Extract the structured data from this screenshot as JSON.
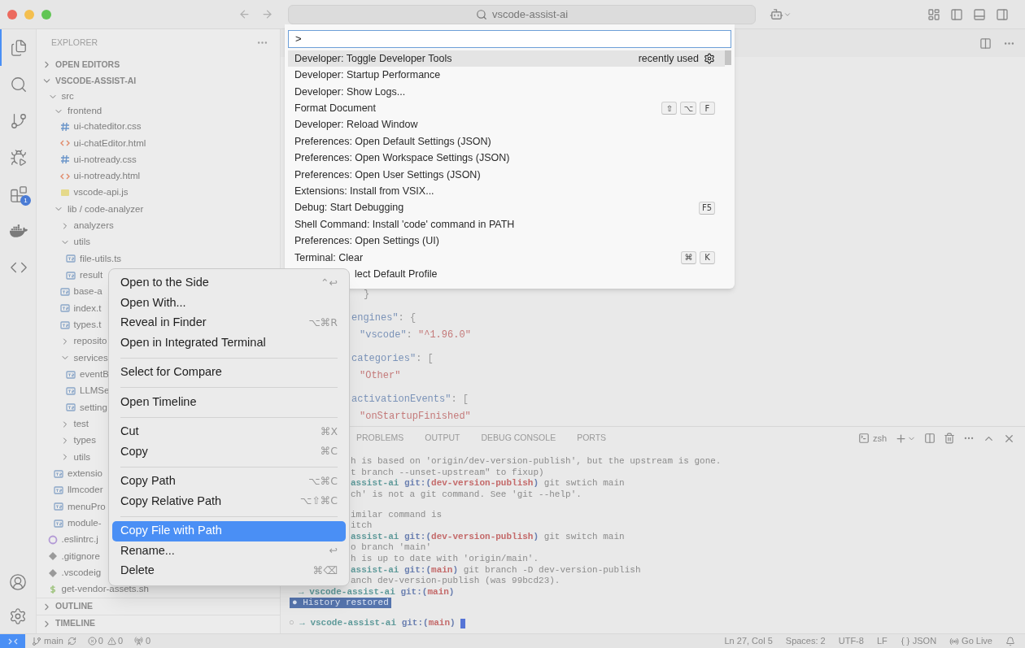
{
  "title_bar": {
    "search": "vscode-assist-ai"
  },
  "activity_bar": {
    "items": [
      {
        "kind": "files",
        "selected": true
      },
      {
        "kind": "search",
        "selected": false
      },
      {
        "kind": "source-control",
        "selected": false
      },
      {
        "kind": "run",
        "selected": false
      },
      {
        "kind": "extensions",
        "selected": false,
        "badge": "1"
      },
      {
        "kind": "docker",
        "selected": false
      },
      {
        "kind": "code",
        "selected": false
      }
    ],
    "bottom": [
      {
        "kind": "account"
      },
      {
        "kind": "settings"
      }
    ]
  },
  "sidebar": {
    "title": "EXPLORER",
    "sections": [
      {
        "label": "OPEN EDITORS",
        "expanded": false
      },
      {
        "label": "VSCODE-ASSIST-AI",
        "expanded": true
      }
    ],
    "tree": [
      {
        "name": "src",
        "kind": "folder",
        "expanded": true,
        "children": [
          {
            "name": "frontend",
            "kind": "folder",
            "expanded": true,
            "children": [
              {
                "name": "ui-chateditor.css",
                "kind": "css"
              },
              {
                "name": "ui-chatEditor.html",
                "kind": "html"
              },
              {
                "name": "ui-notready.css",
                "kind": "css"
              },
              {
                "name": "ui-notready.html",
                "kind": "html"
              },
              {
                "name": "vscode-api.js",
                "kind": "js"
              }
            ]
          },
          {
            "name": "lib / code-analyzer",
            "kind": "folder",
            "expanded": true,
            "children": [
              {
                "name": "analyzers",
                "kind": "folder",
                "expanded": false
              },
              {
                "name": "utils",
                "kind": "folder",
                "expanded": true,
                "children": [
                  {
                    "name": "file-utils.ts",
                    "kind": "ts"
                  },
                  {
                    "name": "result",
                    "kind": "ts"
                  }
                ]
              },
              {
                "name": "base-a",
                "kind": "ts"
              },
              {
                "name": "index.t",
                "kind": "ts"
              },
              {
                "name": "types.t",
                "kind": "ts"
              },
              {
                "name": "reposito",
                "kind": "folder",
                "expanded": false
              },
              {
                "name": "services",
                "kind": "folder",
                "expanded": true,
                "children": [
                  {
                    "name": "eventB",
                    "kind": "ts"
                  },
                  {
                    "name": "LLMSe",
                    "kind": "ts"
                  },
                  {
                    "name": "setting",
                    "kind": "ts"
                  }
                ]
              },
              {
                "name": "test",
                "kind": "folder",
                "expanded": false
              },
              {
                "name": "types",
                "kind": "folder",
                "expanded": false
              },
              {
                "name": "utils",
                "kind": "folder",
                "expanded": false
              }
            ]
          },
          {
            "name": "extensio",
            "kind": "ts"
          },
          {
            "name": "llmcoder",
            "kind": "ts"
          },
          {
            "name": "menuPro",
            "kind": "ts"
          },
          {
            "name": "module-",
            "kind": "ts"
          }
        ]
      },
      {
        "name": ".eslintrc.j",
        "kind": "eslint"
      },
      {
        "name": ".gitignore",
        "kind": "git"
      },
      {
        "name": ".vscodeig",
        "kind": "git"
      },
      {
        "name": "get-vendor-assets.sh",
        "kind": "sh"
      }
    ],
    "bottom_sections": [
      {
        "label": "OUTLINE",
        "expanded": false
      },
      {
        "label": "TIMELINE",
        "expanded": false
      }
    ]
  },
  "command_palette": {
    "input": ">",
    "items": [
      {
        "kind": "command",
        "label": "Developer: Toggle Developer Tools",
        "selected": true,
        "hint": "recently used"
      },
      {
        "kind": "command",
        "label": "Developer: Startup Performance",
        "selected": false
      },
      {
        "kind": "command",
        "label": "Developer: Show Logs...",
        "selected": false
      },
      {
        "kind": "command",
        "label": "Format Document",
        "selected": false,
        "keys": [
          "⇧",
          "⌥",
          "F"
        ]
      },
      {
        "kind": "command",
        "label": "Developer: Reload Window",
        "selected": false
      },
      {
        "kind": "command",
        "label": "Preferences: Open Default Settings (JSON)",
        "selected": false
      },
      {
        "kind": "command",
        "label": "Preferences: Open Workspace Settings (JSON)",
        "selected": false
      },
      {
        "kind": "command",
        "label": "Preferences: Open User Settings (JSON)",
        "selected": false
      },
      {
        "kind": "command",
        "label": "Extensions: Install from VSIX...",
        "selected": false
      },
      {
        "kind": "command",
        "label": "Debug: Start Debugging",
        "selected": false,
        "keys": [
          "F5"
        ]
      },
      {
        "kind": "command",
        "label": "Shell Command: Install 'code' command in PATH",
        "selected": false
      },
      {
        "kind": "command",
        "label": "Preferences: Open Settings (UI)",
        "selected": false
      },
      {
        "kind": "command",
        "label": "Terminal: Clear",
        "selected": false,
        "keys": [
          "⌘",
          "K"
        ]
      },
      {
        "kind": "partial",
        "label": "lect Default Profile",
        "selected": false
      }
    ]
  },
  "context_menu": {
    "items": [
      {
        "kind": "item",
        "label": "Open to the Side",
        "shortcut": "⌃↩",
        "selected": false
      },
      {
        "kind": "item",
        "label": "Open With...",
        "selected": false
      },
      {
        "kind": "item",
        "label": "Reveal in Finder",
        "shortcut": "⌥⌘R",
        "selected": false
      },
      {
        "kind": "item",
        "label": "Open in Integrated Terminal",
        "selected": false
      },
      {
        "kind": "separator"
      },
      {
        "kind": "item",
        "label": "Select for Compare",
        "selected": false
      },
      {
        "kind": "separator"
      },
      {
        "kind": "item",
        "label": "Open Timeline",
        "selected": false
      },
      {
        "kind": "separator"
      },
      {
        "kind": "item",
        "label": "Cut",
        "shortcut": "⌘X",
        "selected": false
      },
      {
        "kind": "item",
        "label": "Copy",
        "shortcut": "⌘C",
        "selected": false
      },
      {
        "kind": "separator"
      },
      {
        "kind": "item",
        "label": "Copy Path",
        "shortcut": "⌥⌘C",
        "selected": false
      },
      {
        "kind": "item",
        "label": "Copy Relative Path",
        "shortcut": "⌥⇧⌘C",
        "selected": false
      },
      {
        "kind": "separator"
      },
      {
        "kind": "item",
        "label": "Copy File with Path",
        "selected": true
      },
      {
        "kind": "item",
        "label": "Rename...",
        "shortcut": "↩",
        "selected": false
      },
      {
        "kind": "item",
        "label": "Delete",
        "shortcut": "⌘⌫",
        "selected": false
      }
    ]
  },
  "editor": {
    "lines": [
      {
        "kind": "brace",
        "parts": [
          {
            "text": "}",
            "kind": "punct"
          }
        ]
      },
      {
        "kind": "blank"
      },
      {
        "kind": "key",
        "parts": [
          {
            "text": "engines\"",
            "kind": "key"
          },
          {
            "text": ": {",
            "kind": "punct"
          }
        ]
      },
      {
        "kind": "value",
        "parts": [
          {
            "text": "\"vscode\"",
            "kind": "key"
          },
          {
            "text": ": ",
            "kind": "punct"
          },
          {
            "text": "\"^1.96.0\"",
            "kind": "string"
          }
        ]
      },
      {
        "kind": "blank"
      },
      {
        "kind": "key",
        "parts": [
          {
            "text": "categories\"",
            "kind": "key"
          },
          {
            "text": ": [",
            "kind": "punct"
          }
        ]
      },
      {
        "kind": "value",
        "parts": [
          {
            "text": "\"Other\"",
            "kind": "string"
          }
        ]
      },
      {
        "kind": "blank"
      },
      {
        "kind": "key",
        "parts": [
          {
            "text": "activationEvents\"",
            "kind": "key"
          },
          {
            "text": ": [",
            "kind": "punct"
          }
        ]
      },
      {
        "kind": "value",
        "parts": [
          {
            "text": "\"onStartupFinished\"",
            "kind": "string"
          }
        ]
      }
    ]
  },
  "panel": {
    "tabs": [
      {
        "label": "PROBLEMS",
        "selected": false
      },
      {
        "label": "OUTPUT",
        "selected": false
      },
      {
        "label": "DEBUG CONSOLE",
        "selected": false
      },
      {
        "label": "PORTS",
        "selected": false
      }
    ],
    "shell": "zsh",
    "terminal_lines": [
      {
        "kind": "clipped",
        "parts": [
          {
            "text": "h is based on 'origin/dev-version-publish', but the upstream is gone.",
            "kind": "plain"
          }
        ]
      },
      {
        "kind": "clipped",
        "parts": [
          {
            "text": "t branch --unset-upstream\" to fixup)",
            "kind": "plain"
          }
        ]
      },
      {
        "kind": "clipped",
        "parts": [
          {
            "text": "assist-ai ",
            "kind": "dir"
          },
          {
            "text": "git:(",
            "kind": "git"
          },
          {
            "text": "dev-version-publish",
            "kind": "branch"
          },
          {
            "text": ") ",
            "kind": "git"
          },
          {
            "text": "git swtich main",
            "kind": "plain"
          }
        ]
      },
      {
        "kind": "clipped",
        "parts": [
          {
            "text": "ch' is not a git command. See 'git --help'.",
            "kind": "plain"
          }
        ]
      },
      {
        "kind": "blank"
      },
      {
        "kind": "clipped",
        "parts": [
          {
            "text": "imilar command is",
            "kind": "plain"
          }
        ]
      },
      {
        "kind": "clipped",
        "parts": [
          {
            "text": "itch",
            "kind": "plain"
          }
        ]
      },
      {
        "kind": "clipped",
        "parts": [
          {
            "text": "assist-ai ",
            "kind": "dir"
          },
          {
            "text": "git:(",
            "kind": "git"
          },
          {
            "text": "dev-version-publish",
            "kind": "branch"
          },
          {
            "text": ") ",
            "kind": "git"
          },
          {
            "text": "git switch main",
            "kind": "plain"
          }
        ]
      },
      {
        "kind": "clipped",
        "parts": [
          {
            "text": "o branch 'main'",
            "kind": "plain"
          }
        ]
      },
      {
        "kind": "clipped",
        "parts": [
          {
            "text": "h is up to date with 'origin/main'.",
            "kind": "plain"
          }
        ]
      },
      {
        "kind": "clipped",
        "parts": [
          {
            "text": "assist-ai ",
            "kind": "dir"
          },
          {
            "text": "git:(",
            "kind": "git"
          },
          {
            "text": "main",
            "kind": "branch"
          },
          {
            "text": ") ",
            "kind": "git"
          },
          {
            "text": "git branch -D dev-version-publish",
            "kind": "plain"
          }
        ]
      },
      {
        "kind": "clipped",
        "parts": [
          {
            "text": "anch dev-version-publish (was 99bcd23).",
            "kind": "plain"
          }
        ]
      },
      {
        "kind": "full",
        "parts": [
          {
            "text": "→ ",
            "kind": "dir"
          },
          {
            "text": "vscode-assist-ai ",
            "kind": "dir"
          },
          {
            "text": "git:(",
            "kind": "git"
          },
          {
            "text": "main",
            "kind": "branch"
          },
          {
            "text": ")",
            "kind": "git"
          }
        ]
      },
      {
        "kind": "highlight",
        "text": "● History restored"
      },
      {
        "kind": "blank"
      },
      {
        "kind": "prompt",
        "cursor": true,
        "parts": [
          {
            "text": "○ ",
            "kind": "dim"
          },
          {
            "text": "→ ",
            "kind": "dir"
          },
          {
            "text": "vscode-assist-ai ",
            "kind": "dir"
          },
          {
            "text": "git:(",
            "kind": "git"
          },
          {
            "text": "main",
            "kind": "branch"
          },
          {
            "text": ") ",
            "kind": "git"
          }
        ]
      }
    ]
  },
  "status_bar": {
    "branch": "main",
    "errors": "0",
    "warnings": "0",
    "ports": "0",
    "right": [
      {
        "kind": "text",
        "label": "Ln 27, Col 5"
      },
      {
        "kind": "text",
        "label": "Spaces: 2"
      },
      {
        "kind": "text",
        "label": "UTF-8"
      },
      {
        "kind": "text",
        "label": "LF"
      },
      {
        "kind": "language",
        "label": "JSON"
      },
      {
        "kind": "live",
        "label": "Go Live"
      },
      {
        "kind": "bell"
      }
    ]
  }
}
